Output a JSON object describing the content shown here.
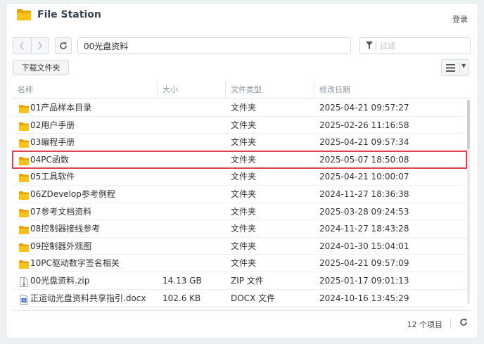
{
  "app": {
    "title": "File Station",
    "login_label": "登录",
    "icon": "folder-icon"
  },
  "toolbar": {
    "back_icon": "chevron-left-icon",
    "forward_icon": "chevron-right-icon",
    "refresh_icon": "refresh-icon",
    "path_value": "00光盘资料",
    "filter_placeholder": "过滤",
    "filter_icon": "filter-icon",
    "download_label": "下载文件夹",
    "view_icon": "list-view-icon"
  },
  "table": {
    "headers": {
      "name": "名称",
      "size": "大小",
      "type": "文件类型",
      "modified": "修改日期"
    },
    "rows": [
      {
        "name": "01产品样本目录",
        "size": "",
        "type": "文件夹",
        "modified": "2025-04-21 09:57:27",
        "icon": "folder-icon"
      },
      {
        "name": "02用户手册",
        "size": "",
        "type": "文件夹",
        "modified": "2025-02-26 11:16:58",
        "icon": "folder-icon"
      },
      {
        "name": "03编程手册",
        "size": "",
        "type": "文件夹",
        "modified": "2025-04-21 09:57:34",
        "icon": "folder-icon"
      },
      {
        "name": "04PC函数",
        "size": "",
        "type": "文件夹",
        "modified": "2025-05-07 18:50:08",
        "icon": "folder-icon",
        "highlighted": true
      },
      {
        "name": "05工具软件",
        "size": "",
        "type": "文件夹",
        "modified": "2025-04-21 10:00:07",
        "icon": "folder-icon"
      },
      {
        "name": "06ZDevelop参考例程",
        "size": "",
        "type": "文件夹",
        "modified": "2024-11-27 18:36:38",
        "icon": "folder-icon"
      },
      {
        "name": "07参考文档资料",
        "size": "",
        "type": "文件夹",
        "modified": "2025-03-28 09:24:53",
        "icon": "folder-icon"
      },
      {
        "name": "08控制器接线参考",
        "size": "",
        "type": "文件夹",
        "modified": "2024-11-27 18:43:28",
        "icon": "folder-icon"
      },
      {
        "name": "09控制器外观图",
        "size": "",
        "type": "文件夹",
        "modified": "2024-01-30 15:04:01",
        "icon": "folder-icon"
      },
      {
        "name": "10PC驱动数字签名相关",
        "size": "",
        "type": "文件夹",
        "modified": "2025-04-21 09:57:09",
        "icon": "folder-icon"
      },
      {
        "name": "00光盘资料.zip",
        "size": "14.13 GB",
        "type": "ZIP 文件",
        "modified": "2025-01-17 09:01:13",
        "icon": "zip-file-icon"
      },
      {
        "name": "正运动光盘资料共享指引.docx",
        "size": "102.6 KB",
        "type": "DOCX 文件",
        "modified": "2024-10-16 13:45:29",
        "icon": "word-file-icon"
      }
    ]
  },
  "footer": {
    "item_count": "12 个项目",
    "refresh_icon": "refresh-icon"
  },
  "colors": {
    "folder": "#f5b800",
    "highlight_border": "#e0434f",
    "word_blue": "#2b5eb8"
  }
}
